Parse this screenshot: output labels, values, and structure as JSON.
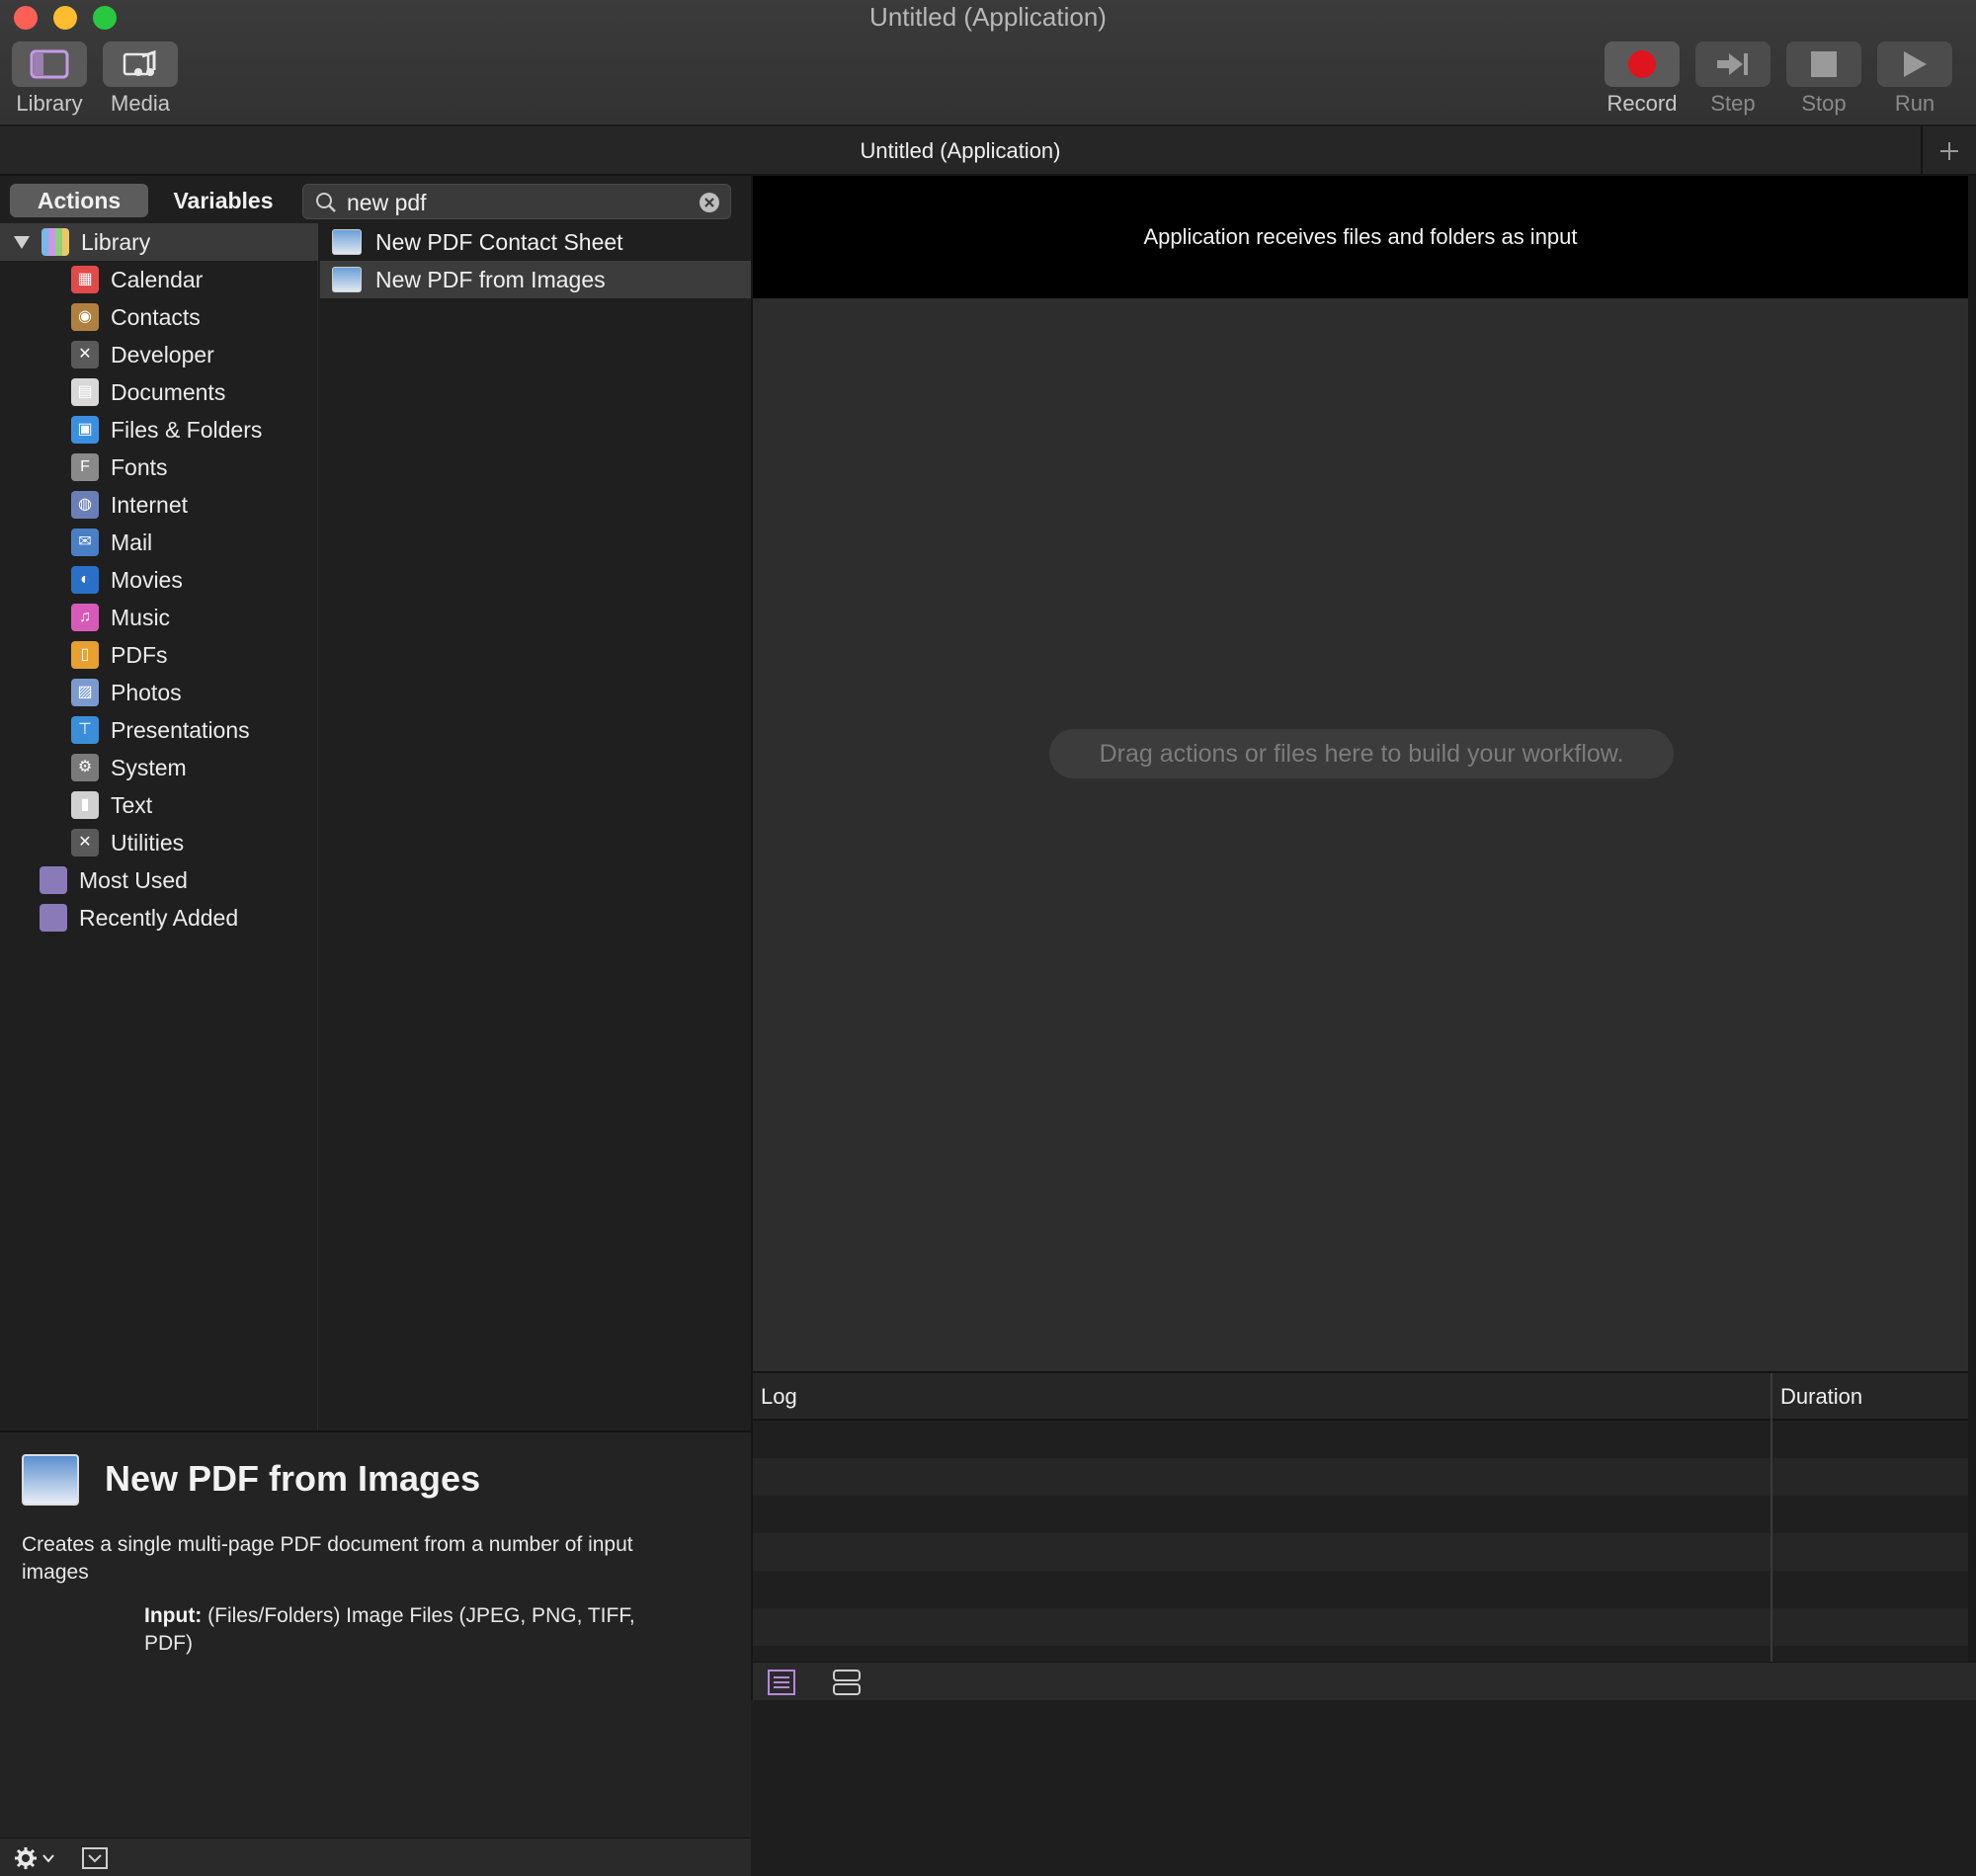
{
  "window": {
    "title": "Untitled (Application)",
    "tab_title": "Untitled (Application)"
  },
  "toolbar": {
    "library_label": "Library",
    "media_label": "Media",
    "record_label": "Record",
    "step_label": "Step",
    "stop_label": "Stop",
    "run_label": "Run"
  },
  "left": {
    "tab_actions": "Actions",
    "tab_variables": "Variables",
    "search_value": "new pdf",
    "library_root": "Library",
    "categories": [
      "Calendar",
      "Contacts",
      "Developer",
      "Documents",
      "Files & Folders",
      "Fonts",
      "Internet",
      "Mail",
      "Movies",
      "Music",
      "PDFs",
      "Photos",
      "Presentations",
      "System",
      "Text",
      "Utilities"
    ],
    "smart_groups": [
      "Most Used",
      "Recently Added"
    ],
    "actions": [
      "New PDF Contact Sheet",
      "New PDF from Images"
    ]
  },
  "description": {
    "title": "New PDF from Images",
    "text": "Creates a single multi-page PDF document from a number of input images",
    "input_label": "Input:",
    "input_value": "(Files/Folders) Image Files (JPEG, PNG, TIFF, PDF)"
  },
  "workflow": {
    "banner": "Application receives files and folders as input",
    "drop_hint": "Drag actions or files here to build your workflow."
  },
  "log": {
    "col_log": "Log",
    "col_duration": "Duration"
  },
  "colors": {
    "record_red": "#e0141e",
    "library_purple": "#b58ad8"
  }
}
